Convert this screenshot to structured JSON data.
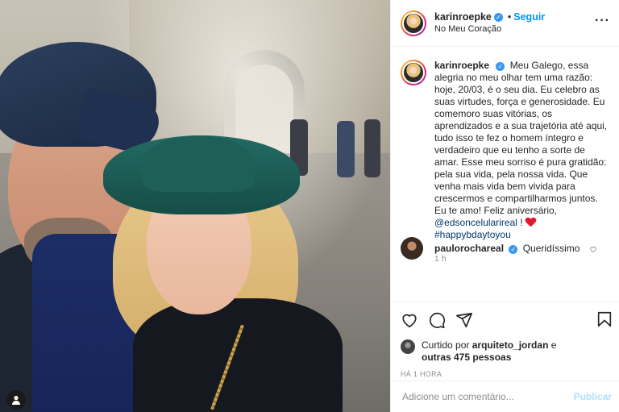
{
  "photo": {
    "alt_icon": "tag-person-icon"
  },
  "header": {
    "username": "karinroepke",
    "verified": true,
    "separator": "•",
    "follow_label": "Seguir",
    "location": "No Meu Coração",
    "more_label": "···"
  },
  "caption": {
    "username": "karinroepke",
    "text_1": "Meu Galego, essa alegria no meu olhar tem uma razão: hoje, 20/03, é o seu dia. Eu celebro as suas virtudes, força e generosidade. Eu comemoro suas vitórias, os aprendizados e a sua trajetória até aqui, tudo isso te fez o homem íntegro e verdadeiro que eu tenho a sorte de amar. Esse meu sorriso é pura gratidão: pela sua vida, pela nossa vida. Que venha mais vida bem vivida para crescermos e compartilharmos juntos. Eu te amo! Feliz aniversário,",
    "mention": "@edsoncelularireal",
    "text_2": " !",
    "hashtag": "#happybdaytoyou",
    "time": "1 h"
  },
  "reply": {
    "username": "paulorochareal",
    "text": "Queridíssimo"
  },
  "likes": {
    "prefix": "Curtido por",
    "user": "arquiteto_jordan",
    "conj": "e",
    "others": "outras 475 pessoas"
  },
  "posted_ago": "HÁ 1 HORA",
  "comment_box": {
    "placeholder": "Adicione um comentário...",
    "publish_label": "Publicar"
  }
}
